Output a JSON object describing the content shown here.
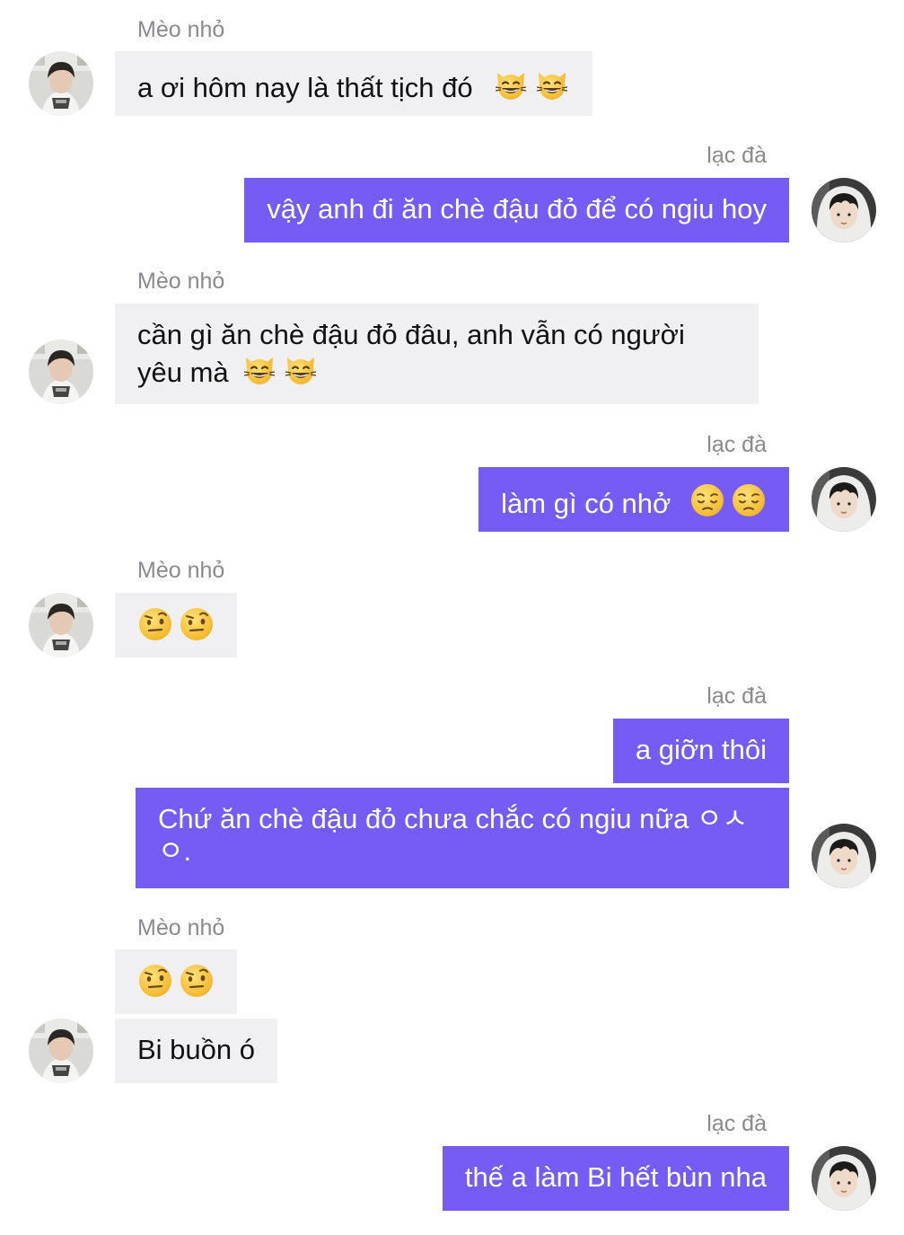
{
  "contacts": {
    "left_name": "Mèo nhỏ",
    "right_name": "lạc đà"
  },
  "messages": [
    {
      "side": "in",
      "text": "a ơi hôm nay là thất tịch đó",
      "emoji": [
        "grinning-cat-icon",
        "grinning-cat-icon"
      ]
    },
    {
      "side": "out",
      "text": "vậy anh đi ăn chè đậu đỏ để có ngiu hoy"
    },
    {
      "side": "in",
      "text": "cần gì ăn chè đậu đỏ đâu, anh vẫn có người yêu mà",
      "emoji": [
        "grinning-cat-icon",
        "grinning-cat-icon"
      ]
    },
    {
      "side": "out",
      "text": "làm gì có nhở",
      "emoji": [
        "pensive-face-icon",
        "pensive-face-icon"
      ]
    },
    {
      "side": "in",
      "text": "",
      "emoji": [
        "raised-eyebrow-face-icon",
        "raised-eyebrow-face-icon"
      ]
    },
    {
      "side": "out",
      "text": "a giỡn thôi"
    },
    {
      "side": "out",
      "text": "Chứ ăn chè đậu đỏ chưa chắc có ngiu nữa ㅇㅅㅇ."
    },
    {
      "side": "in",
      "text": "",
      "emoji": [
        "raised-eyebrow-face-icon",
        "raised-eyebrow-face-icon"
      ]
    },
    {
      "side": "in",
      "text": "Bi buồn ó"
    },
    {
      "side": "out",
      "text": "thế a làm Bi hết bùn nha"
    }
  ],
  "colors": {
    "outgoing_bubble": "#765cf5",
    "incoming_bubble": "#f0f0f2",
    "sender_name": "#8a8a8e"
  }
}
